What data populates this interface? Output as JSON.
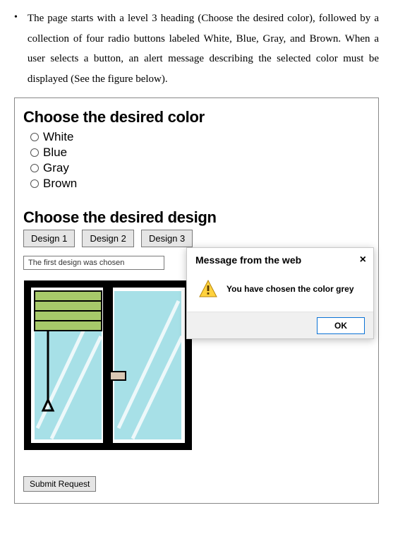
{
  "bullet_text": "The page starts with a level 3 heading (Choose the desired color), followed by a collection of four radio buttons labeled White, Blue, Gray, and Brown. When a user selects a button, an alert message describing the selected color must be displayed (See the figure below).",
  "heading_color": "Choose the desired color",
  "radios": {
    "r0": "White",
    "r1": "Blue",
    "r2": "Gray",
    "r3": "Brown"
  },
  "heading_design": "Choose the desired design",
  "design_buttons": {
    "b0": "Design 1",
    "b1": "Design 2",
    "b2": "Design 3"
  },
  "readonly_text": "The first design was chosen",
  "alert": {
    "title": "Message from the web",
    "close": "×",
    "body": "You have chosen the color grey",
    "ok": "OK"
  },
  "submit_label": "Submit Request"
}
